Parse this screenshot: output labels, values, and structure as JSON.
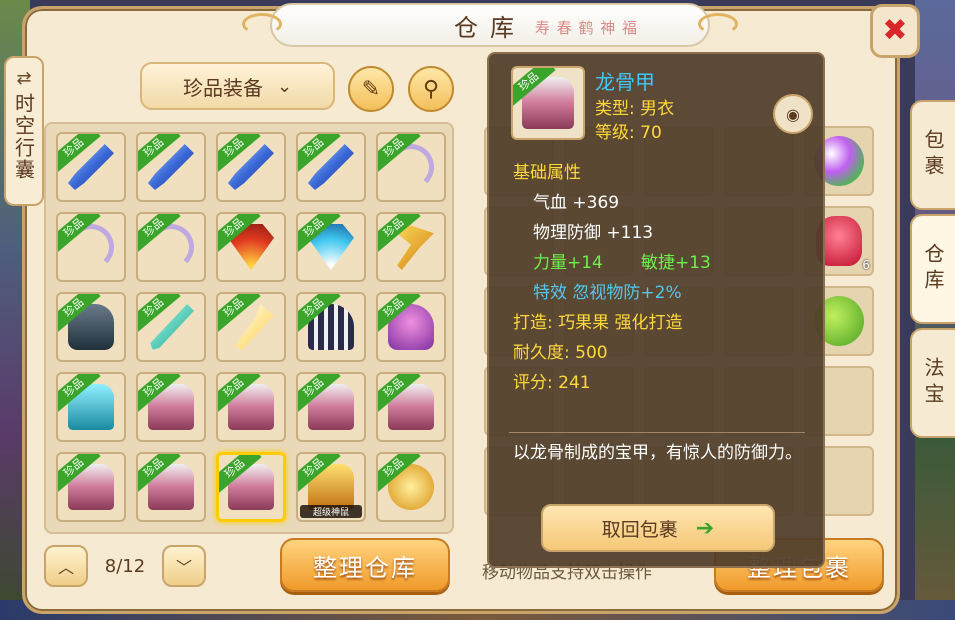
{
  "window": {
    "title": "仓库",
    "title_decoration": "寿 春 鹤 神 福"
  },
  "left_side_tab": {
    "swap_icon": "⇄",
    "label": "时空行囊"
  },
  "left_panel": {
    "category_dropdown": "珍品装备",
    "edit_icon": "✎",
    "search_icon": "⚲",
    "ribbon_label": "珍品",
    "items": [
      {
        "art": "sword"
      },
      {
        "art": "sword"
      },
      {
        "art": "sword"
      },
      {
        "art": "sword"
      },
      {
        "art": "bow"
      },
      {
        "art": "bow"
      },
      {
        "art": "bow"
      },
      {
        "art": "fan-red"
      },
      {
        "art": "fan-blue"
      },
      {
        "art": "axe"
      },
      {
        "art": "helm-dark"
      },
      {
        "art": "spear"
      },
      {
        "art": "staff"
      },
      {
        "art": "helm-stripe"
      },
      {
        "art": "helm-purple"
      },
      {
        "art": "armor-teal"
      },
      {
        "art": "armor-pink"
      },
      {
        "art": "armor-pink"
      },
      {
        "art": "armor-pink"
      },
      {
        "art": "armor-pink"
      },
      {
        "art": "armor-pink"
      },
      {
        "art": "armor-pink"
      },
      {
        "art": "armor-pink",
        "selected": true
      },
      {
        "art": "armor-gold",
        "tag": "超级神鼠"
      },
      {
        "art": "scroll-gold"
      }
    ],
    "page_indicator": "8/12",
    "prev_icon": "︿",
    "next_icon": "﹀",
    "sort_button": "整理仓库"
  },
  "right_panel": {
    "hint": "移动物品支持双击操作",
    "sort_button": "整理包裹",
    "bag_red_count": "6"
  },
  "right_tabs": [
    {
      "label": "包裹",
      "active": false
    },
    {
      "label": "仓库",
      "active": true
    },
    {
      "label": "法宝",
      "active": false
    }
  ],
  "tooltip": {
    "ribbon_label": "珍品",
    "name": "龙骨甲",
    "type_line": "类型: 男衣",
    "level_line": "等级: 70",
    "eye_icon": "◉",
    "section_title": "基础属性",
    "hp": "气血 +369",
    "phys_def": "物理防御 +113",
    "strength": "力量+14",
    "agility": "敏捷+13",
    "special": "特效 忽视物防+2%",
    "crafted": "打造: 巧果果   强化打造",
    "durability": "耐久度: 500",
    "score": "评分: 241",
    "description": "以龙骨制成的宝甲，有惊人的防御力。",
    "retrieve_button": "取回包裹",
    "retrieve_arrow": "➔"
  },
  "close_icon": "✖",
  "colors": {
    "accent": "#f09a2a",
    "name_blue": "#3ec8ff",
    "stat_yellow": "#ffd83a",
    "stat_green": "#6ef04a",
    "special_blue": "#52c8f0"
  }
}
